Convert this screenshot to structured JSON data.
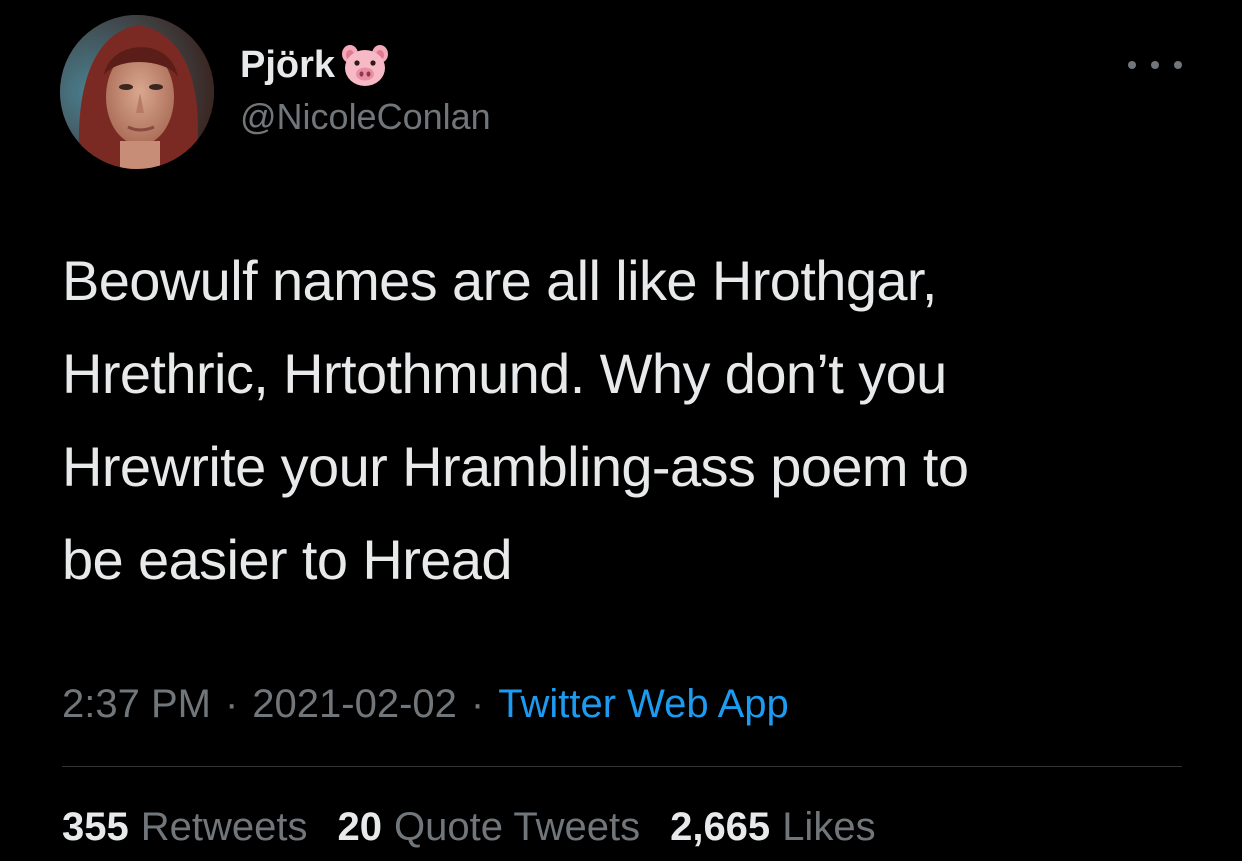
{
  "user": {
    "display_name": "Pjörk",
    "handle": "@NicoleConlan",
    "badge_icon": "pig-face-emoji",
    "avatar_icon": "profile-photo"
  },
  "tweet": {
    "text_lines": [
      "Beowulf names are all like Hrothgar,",
      "Hrethric, Hrtothmund. Why don’t you",
      "Hrewrite your Hrambling-ass poem to",
      "be easier to Hread"
    ],
    "time": "2:37 PM",
    "separator": "·",
    "date": "2021-02-02",
    "source": "Twitter Web App"
  },
  "stats": {
    "retweets": {
      "count": "355",
      "label": "Retweets"
    },
    "quotes": {
      "count": "20",
      "label": "Quote Tweets"
    },
    "likes": {
      "count": "2,665",
      "label": "Likes"
    }
  },
  "colors": {
    "background": "#000000",
    "text_primary": "#e7e9ea",
    "text_secondary": "#71767b",
    "link": "#1d9bf0",
    "divider": "#2f3336"
  }
}
